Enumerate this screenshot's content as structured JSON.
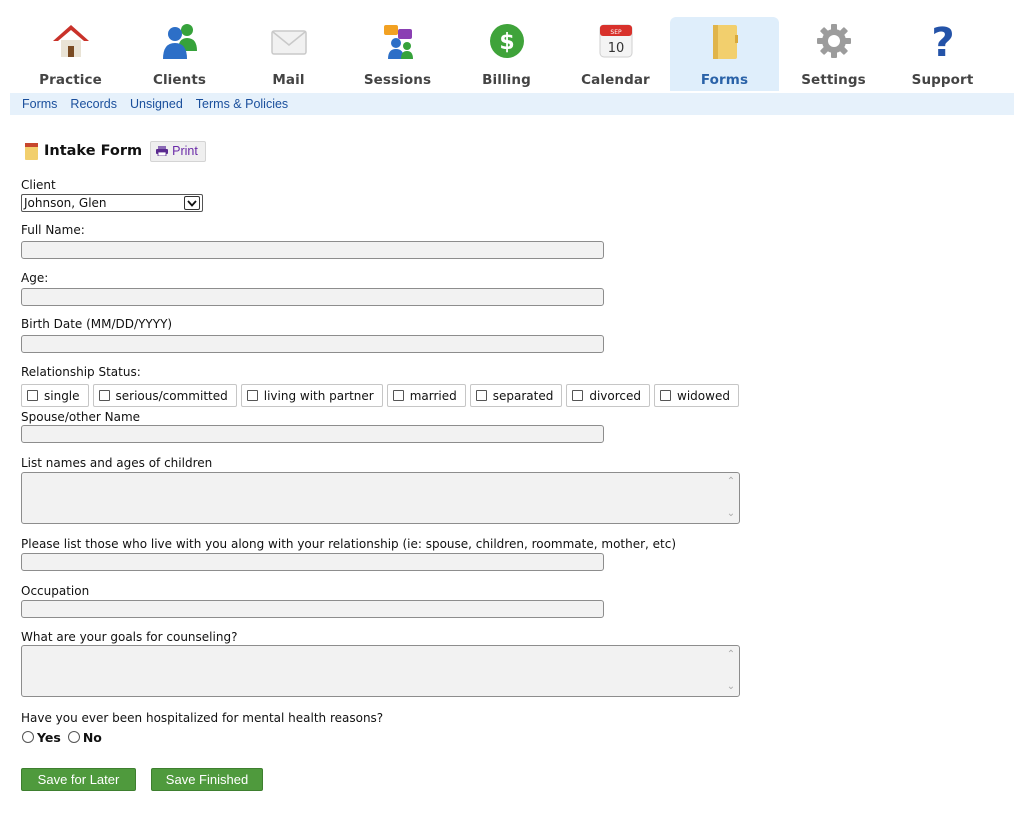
{
  "nav": {
    "items": [
      {
        "label": "Practice",
        "icon": "house-icon"
      },
      {
        "label": "Clients",
        "icon": "people-icon"
      },
      {
        "label": "Mail",
        "icon": "envelope-icon"
      },
      {
        "label": "Sessions",
        "icon": "chat-bubbles-icon"
      },
      {
        "label": "Billing",
        "icon": "dollar-icon"
      },
      {
        "label": "Calendar",
        "icon": "calendar-icon",
        "calendar_month": "SEP",
        "calendar_day": "10"
      },
      {
        "label": "Forms",
        "icon": "folder-icon",
        "active": true
      },
      {
        "label": "Settings",
        "icon": "gear-icon"
      },
      {
        "label": "Support",
        "icon": "question-icon"
      }
    ],
    "active_color": "#2a62a8"
  },
  "subnav": {
    "links": [
      "Forms",
      "Records",
      "Unsigned",
      "Terms & Policies"
    ]
  },
  "form": {
    "title": "Intake Form",
    "print_label": "Print",
    "client_label": "Client",
    "client_value": "Johnson, Glen",
    "full_name_label": "Full Name:",
    "full_name_value": "",
    "age_label": "Age:",
    "age_value": "",
    "birth_date_label": "Birth Date (MM/DD/YYYY)",
    "birth_date_value": "",
    "relationship_label": "Relationship Status:",
    "relationship_options": [
      "single",
      "serious/committed",
      "living with partner",
      "married",
      "separated",
      "divorced",
      "widowed"
    ],
    "spouse_label": "Spouse/other Name",
    "spouse_value": "",
    "children_label": "List names and ages of children",
    "children_value": "",
    "household_label": "Please list those who live with you along with your relationship (ie: spouse, children, roommate, mother, etc)",
    "household_value": "",
    "occupation_label": "Occupation",
    "occupation_value": "",
    "goals_label": "What are your goals for counseling?",
    "goals_value": "",
    "hospitalized_label": "Have you ever been hospitalized for mental health reasons?",
    "yes_label": "Yes",
    "no_label": "No",
    "save_later_label": "Save for Later",
    "save_finished_label": "Save Finished"
  },
  "colors": {
    "button_green": "#4f9a3d",
    "subnav_bg": "#e6f1fb",
    "link_blue": "#1a4f9c"
  }
}
